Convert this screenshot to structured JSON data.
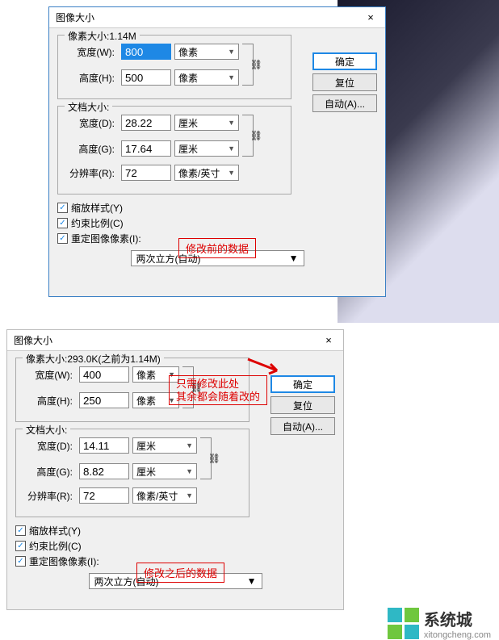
{
  "dialog1": {
    "title": "图像大小",
    "close": "×",
    "pixel_size_legend": "像素大小:1.14M",
    "width_label": "宽度(W):",
    "width_value": "800",
    "width_unit": "像素",
    "height_label": "高度(H):",
    "height_value": "500",
    "height_unit": "像素",
    "doc_size_legend": "文档大小:",
    "doc_width_label": "宽度(D):",
    "doc_width_value": "28.22",
    "doc_width_unit": "厘米",
    "doc_height_label": "高度(G):",
    "doc_height_value": "17.64",
    "doc_height_unit": "厘米",
    "resolution_label": "分辨率(R):",
    "resolution_value": "72",
    "resolution_unit": "像素/英寸",
    "cb_scale": "缩放样式(Y)",
    "cb_constrain": "约束比例(C)",
    "cb_resample": "重定图像像素(I):",
    "resample_method": "两次立方(自动)",
    "btn_ok": "确定",
    "btn_reset": "复位",
    "btn_auto": "自动(A)...",
    "annotation": "修改前的数据"
  },
  "dialog2": {
    "title": "图像大小",
    "close": "×",
    "pixel_size_legend": "像素大小:293.0K(之前为1.14M)",
    "width_label": "宽度(W):",
    "width_value": "400",
    "width_unit": "像素",
    "height_label": "高度(H):",
    "height_value": "250",
    "height_unit": "像素",
    "doc_size_legend": "文档大小:",
    "doc_width_label": "宽度(D):",
    "doc_width_value": "14.11",
    "doc_width_unit": "厘米",
    "doc_height_label": "高度(G):",
    "doc_height_value": "8.82",
    "doc_height_unit": "厘米",
    "resolution_label": "分辨率(R):",
    "resolution_value": "72",
    "resolution_unit": "像素/英寸",
    "cb_scale": "缩放样式(Y)",
    "cb_constrain": "约束比例(C)",
    "cb_resample": "重定图像像素(I):",
    "resample_method": "两次立方(自动)",
    "btn_ok": "确定",
    "btn_reset": "复位",
    "btn_auto": "自动(A)...",
    "annotation1": "只需修改此处\n其余都会随着改的",
    "annotation2": "修改之后的数据"
  },
  "logo": {
    "main": "系统城",
    "sub": "xitongcheng.com"
  }
}
